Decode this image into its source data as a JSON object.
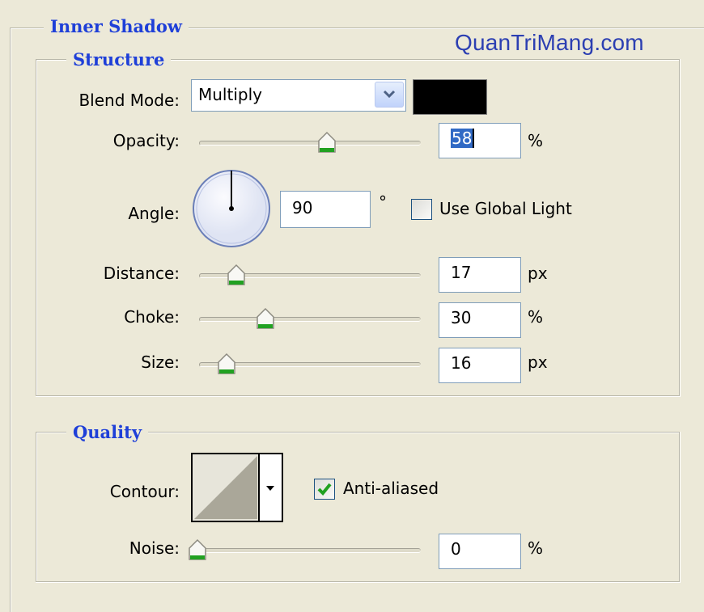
{
  "watermark": "QuanTriMang.com",
  "groups": {
    "inner_shadow": "Inner Shadow",
    "structure": "Structure",
    "quality": "Quality"
  },
  "structure": {
    "blend_mode": {
      "label": "Blend Mode:",
      "value": "Multiply",
      "color": "#000000"
    },
    "opacity": {
      "label": "Opacity:",
      "value": "58",
      "unit": "%",
      "slider_percent": 58
    },
    "angle": {
      "label": "Angle:",
      "value": "90",
      "unit": "°",
      "use_global_light": {
        "label": "Use Global Light",
        "checked": false
      }
    },
    "distance": {
      "label": "Distance:",
      "value": "17",
      "unit": "px",
      "slider_percent": 17
    },
    "choke": {
      "label": "Choke:",
      "value": "30",
      "unit": "%",
      "slider_percent": 30
    },
    "size": {
      "label": "Size:",
      "value": "16",
      "unit": "px",
      "slider_percent": 13
    }
  },
  "quality": {
    "contour": {
      "label": "Contour:",
      "icon": "linear-contour-icon"
    },
    "anti_aliased": {
      "label": "Anti-aliased",
      "checked": true
    },
    "noise": {
      "label": "Noise:",
      "value": "0",
      "unit": "%",
      "slider_percent": 0
    }
  },
  "colors": {
    "group_title": "#1e3fd8",
    "watermark": "#2c3fb2",
    "background": "#ece9d8",
    "thumb_green": "#21a121"
  }
}
